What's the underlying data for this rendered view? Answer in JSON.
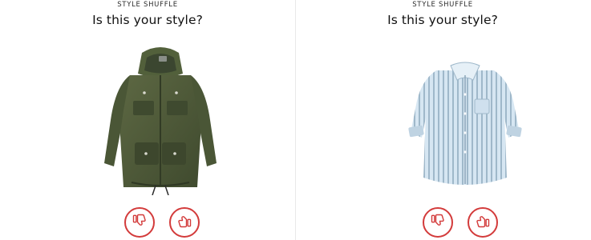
{
  "cards": [
    {
      "eyebrow": "STYLE SHUFFLE",
      "title": "Is this your style?",
      "item_icon": "olive-utility-jacket",
      "buttons": {
        "dislike_icon": "thumbs-down-icon",
        "like_icon": "thumbs-up-icon"
      }
    },
    {
      "eyebrow": "STYLE SHUFFLE",
      "title": "Is this your style?",
      "item_icon": "striped-button-up-shirt",
      "buttons": {
        "dislike_icon": "thumbs-down-icon",
        "like_icon": "thumbs-up-icon"
      }
    }
  ],
  "colors": {
    "accent": "#d33b3b",
    "jacket": "#4f5a3a",
    "shirt": "#c9dbe8"
  }
}
